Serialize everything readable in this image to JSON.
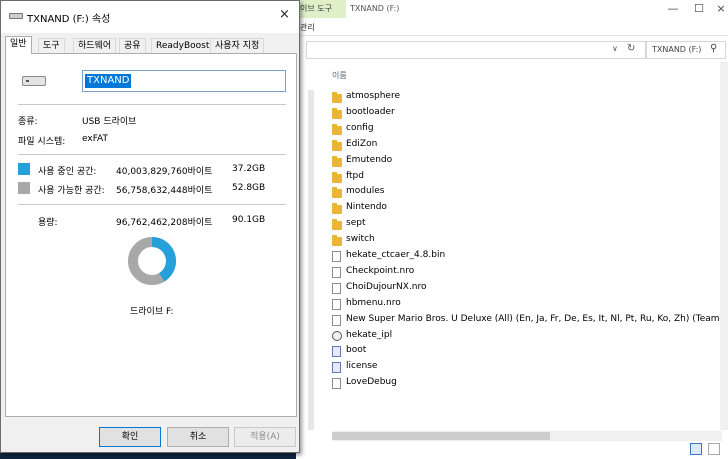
{
  "explorer": {
    "ribbon_tab": "이브 도구",
    "title": "TXNAND (F:)",
    "ribbon_manage": "관리",
    "search_placeholder": "TXNAND (F:)",
    "column_name": "이름",
    "files": [
      {
        "name": "atmosphere",
        "icon": "folder-icon"
      },
      {
        "name": "bootloader",
        "icon": "folder-icon"
      },
      {
        "name": "config",
        "icon": "folder-icon"
      },
      {
        "name": "EdiZon",
        "icon": "folder-icon"
      },
      {
        "name": "Emutendo",
        "icon": "folder-icon"
      },
      {
        "name": "ftpd",
        "icon": "folder-icon"
      },
      {
        "name": "modules",
        "icon": "folder-icon"
      },
      {
        "name": "Nintendo",
        "icon": "folder-icon"
      },
      {
        "name": "sept",
        "icon": "folder-icon"
      },
      {
        "name": "switch",
        "icon": "folder-icon"
      },
      {
        "name": "hekate_ctcaer_4.8.bin",
        "icon": "file-icon"
      },
      {
        "name": "Checkpoint.nro",
        "icon": "file-icon"
      },
      {
        "name": "ChoiDujourNX.nro",
        "icon": "file-icon"
      },
      {
        "name": "hbmenu.nro",
        "icon": "file-icon"
      },
      {
        "name": "New Super Mario Bros. U Deluxe (All) (En, Ja, Fr, De, Es, It, Nl, Pt, Ru, Ko, Zh) (Team HR).xci",
        "icon": "file-icon"
      },
      {
        "name": "hekate_ipl",
        "icon": "settings-file-icon"
      },
      {
        "name": "boot",
        "icon": "system-file-icon"
      },
      {
        "name": "license",
        "icon": "system-file-icon"
      },
      {
        "name": "LoveDebug",
        "icon": "file-icon"
      }
    ]
  },
  "dialog": {
    "title": "TXNAND (F:) 속성",
    "tabs": [
      "일반",
      "도구",
      "하드웨어",
      "공유",
      "ReadyBoost",
      "사용자 지정"
    ],
    "active_tab": "일반",
    "volume_name": "TXNAND",
    "type_label": "종류:",
    "type_value": "USB 드라이브",
    "fs_label": "파일 시스템:",
    "fs_value": "exFAT",
    "used_label": "사용 중인 공간:",
    "used_bytes": "40,003,829,760바이트",
    "used_gb": "37.2GB",
    "free_label": "사용 가능한 공간:",
    "free_bytes": "56,758,632,448바이트",
    "free_gb": "52.8GB",
    "capacity_label": "용량:",
    "capacity_bytes": "96,762,462,208바이트",
    "capacity_gb": "90.1GB",
    "drive_caption": "드라이브 F:",
    "ok_label": "확인",
    "cancel_label": "취소",
    "apply_label": "적용(A)",
    "used_fraction": 0.413,
    "colors": {
      "used": "#26a0da",
      "free": "#a8a8a8",
      "accent": "#0078d7"
    }
  }
}
